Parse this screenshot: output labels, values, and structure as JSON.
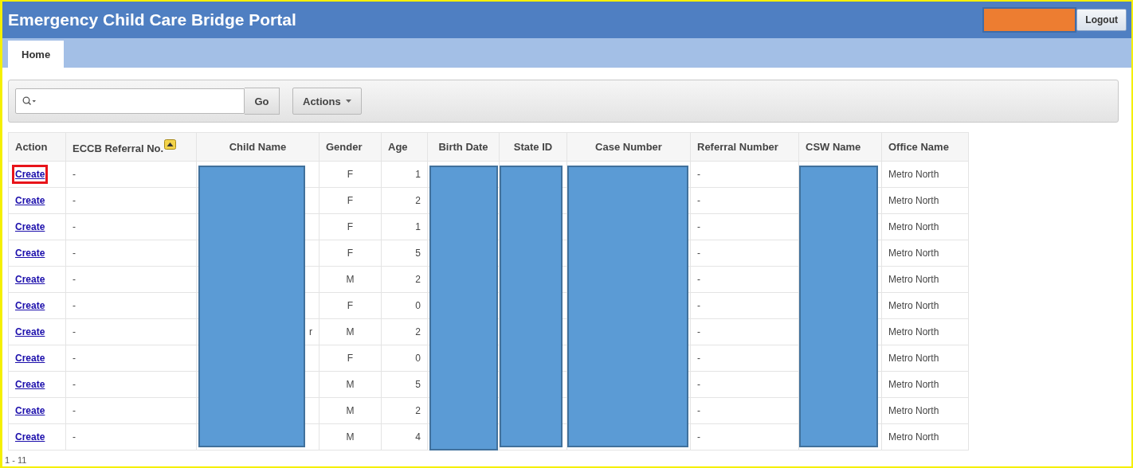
{
  "header": {
    "title": "Emergency Child Care Bridge Portal",
    "logout": "Logout"
  },
  "tabs": [
    {
      "label": "Home",
      "selected": true
    }
  ],
  "toolbar": {
    "go": "Go",
    "actions": "Actions"
  },
  "table": {
    "columns": [
      {
        "label": "Action",
        "sorted": false,
        "redacted": false
      },
      {
        "label": "ECCB Referral No.",
        "sorted": true,
        "redacted": false
      },
      {
        "label": "Child Name",
        "sorted": false,
        "redacted": true
      },
      {
        "label": "Gender",
        "sorted": false,
        "redacted": false
      },
      {
        "label": "Age",
        "sorted": false,
        "redacted": false
      },
      {
        "label": "Birth Date",
        "sorted": false,
        "redacted": true
      },
      {
        "label": "State ID",
        "sorted": false,
        "redacted": true
      },
      {
        "label": "Case Number",
        "sorted": false,
        "redacted": true
      },
      {
        "label": "Referral Number",
        "sorted": false,
        "redacted": false
      },
      {
        "label": "CSW Name",
        "sorted": false,
        "redacted": true
      },
      {
        "label": "Office Name",
        "sorted": false,
        "redacted": false
      }
    ],
    "rows": [
      {
        "action": "Create",
        "highlighted": true,
        "eccb": "-",
        "gender": "F",
        "age": "1",
        "referral": "-",
        "office": "Metro North"
      },
      {
        "action": "Create",
        "highlighted": false,
        "eccb": "-",
        "gender": "F",
        "age": "2",
        "referral": "-",
        "office": "Metro North"
      },
      {
        "action": "Create",
        "highlighted": false,
        "eccb": "-",
        "gender": "F",
        "age": "1",
        "referral": "-",
        "office": "Metro North"
      },
      {
        "action": "Create",
        "highlighted": false,
        "eccb": "-",
        "gender": "F",
        "age": "5",
        "referral": "-",
        "office": "Metro North"
      },
      {
        "action": "Create",
        "highlighted": false,
        "eccb": "-",
        "gender": "M",
        "age": "2",
        "referral": "-",
        "office": "Metro North"
      },
      {
        "action": "Create",
        "highlighted": false,
        "eccb": "-",
        "gender": "F",
        "age": "0",
        "referral": "-",
        "office": "Metro North"
      },
      {
        "action": "Create",
        "highlighted": false,
        "eccb": "-",
        "child_name": "r",
        "gender": "M",
        "age": "2",
        "referral": "-",
        "office": "Metro North"
      },
      {
        "action": "Create",
        "highlighted": false,
        "eccb": "-",
        "gender": "F",
        "age": "0",
        "referral": "-",
        "office": "Metro North"
      },
      {
        "action": "Create",
        "highlighted": false,
        "eccb": "-",
        "gender": "M",
        "age": "5",
        "referral": "-",
        "office": "Metro North"
      },
      {
        "action": "Create",
        "highlighted": false,
        "eccb": "-",
        "gender": "M",
        "age": "2",
        "referral": "-",
        "office": "Metro North"
      },
      {
        "action": "Create",
        "highlighted": false,
        "eccb": "-",
        "gender": "M",
        "age": "4",
        "referral": "-",
        "office": "Metro North"
      }
    ],
    "range": "1 - 11"
  }
}
